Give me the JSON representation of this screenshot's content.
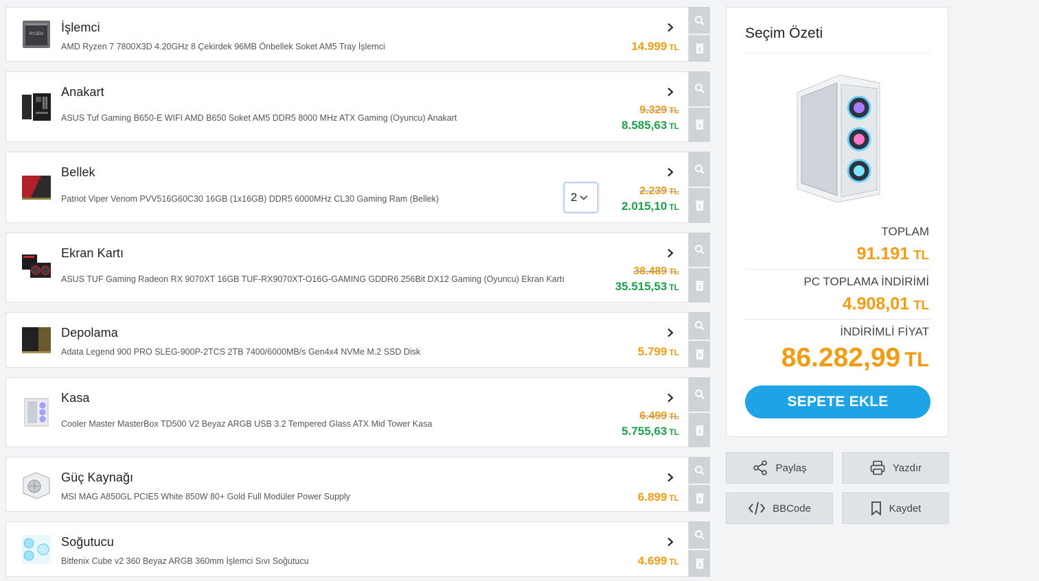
{
  "parts": [
    {
      "category": "İşlemci",
      "description": "AMD Ryzen 7 7800X3D 4.20GHz 8 Çekirdek 96MB Önbellek Soket AM5 Tray İşlemci",
      "price": "14.999",
      "currency": "TL",
      "thumb_icon": "cpu-icon"
    },
    {
      "category": "Anakart",
      "description": "ASUS Tuf Gaming B650-E WIFI AMD B650 Soket AM5 DDR5 8000 MHz ATX Gaming (Oyuncu) Anakart",
      "old_price": "9.329",
      "price": "8.585,63",
      "currency": "TL",
      "thumb_icon": "motherboard-icon"
    },
    {
      "category": "Bellek",
      "description": "Patriot Viper Venom PVV516G60C30 16GB (1x16GB) DDR5 6000MHz CL30 Gaming Ram (Bellek)",
      "old_price": "2.239",
      "price": "2.015,10",
      "currency": "TL",
      "quantity": "2",
      "thumb_icon": "ram-icon"
    },
    {
      "category": "Ekran Kartı",
      "description": "ASUS TUF Gaming Radeon RX 9070XT 16GB TUF-RX9070XT-O16G-GAMING GDDR6 256Bit DX12 Gaming (Oyuncu) Ekran Kartı",
      "old_price": "38.489",
      "price": "35.515,53",
      "currency": "TL",
      "thumb_icon": "gpu-icon"
    },
    {
      "category": "Depolama",
      "description": "Adata Legend 900 PRO SLEG-900P-2TCS 2TB 7400/6000MB/s Gen4x4 NVMe M.2 SSD Disk",
      "price": "5.799",
      "currency": "TL",
      "thumb_icon": "ssd-icon"
    },
    {
      "category": "Kasa",
      "description": "Cooler Master MasterBox TD500 V2 Beyaz ARGB USB 3.2 Tempered Glass ATX Mid Tower Kasa",
      "old_price": "6.499",
      "price": "5.755,63",
      "currency": "TL",
      "thumb_icon": "case-icon"
    },
    {
      "category": "Güç Kaynağı",
      "description": "MSI MAG A850GL PCIE5 White 850W 80+ Gold Full Modüler Power Supply",
      "price": "6.899",
      "currency": "TL",
      "thumb_icon": "psu-icon"
    },
    {
      "category": "Soğutucu",
      "description": "Bitfenix Cube v2 360 Beyaz ARGB 360mm İşlemci Sıvı Soğutucu",
      "price": "4.699",
      "currency": "TL",
      "thumb_icon": "cooler-icon"
    }
  ],
  "summary": {
    "title": "Seçim Özeti",
    "total_label": "TOPLAM",
    "total_value": "91.191",
    "discount_label": "PC TOPLAMA İNDİRİMİ",
    "discount_value": "4.908,01",
    "final_label": "İNDİRİMLİ FİYAT",
    "final_value": "86.282,99",
    "currency": "TL",
    "add_to_cart": "SEPETE EKLE"
  },
  "actions": {
    "share": "Paylaş",
    "print": "Yazdır",
    "bbcode": "BBCode",
    "save": "Kaydet"
  },
  "colors": {
    "price_orange": "#f39c12",
    "price_green": "#1e9e4a",
    "cta_blue": "#1ea3e6"
  }
}
